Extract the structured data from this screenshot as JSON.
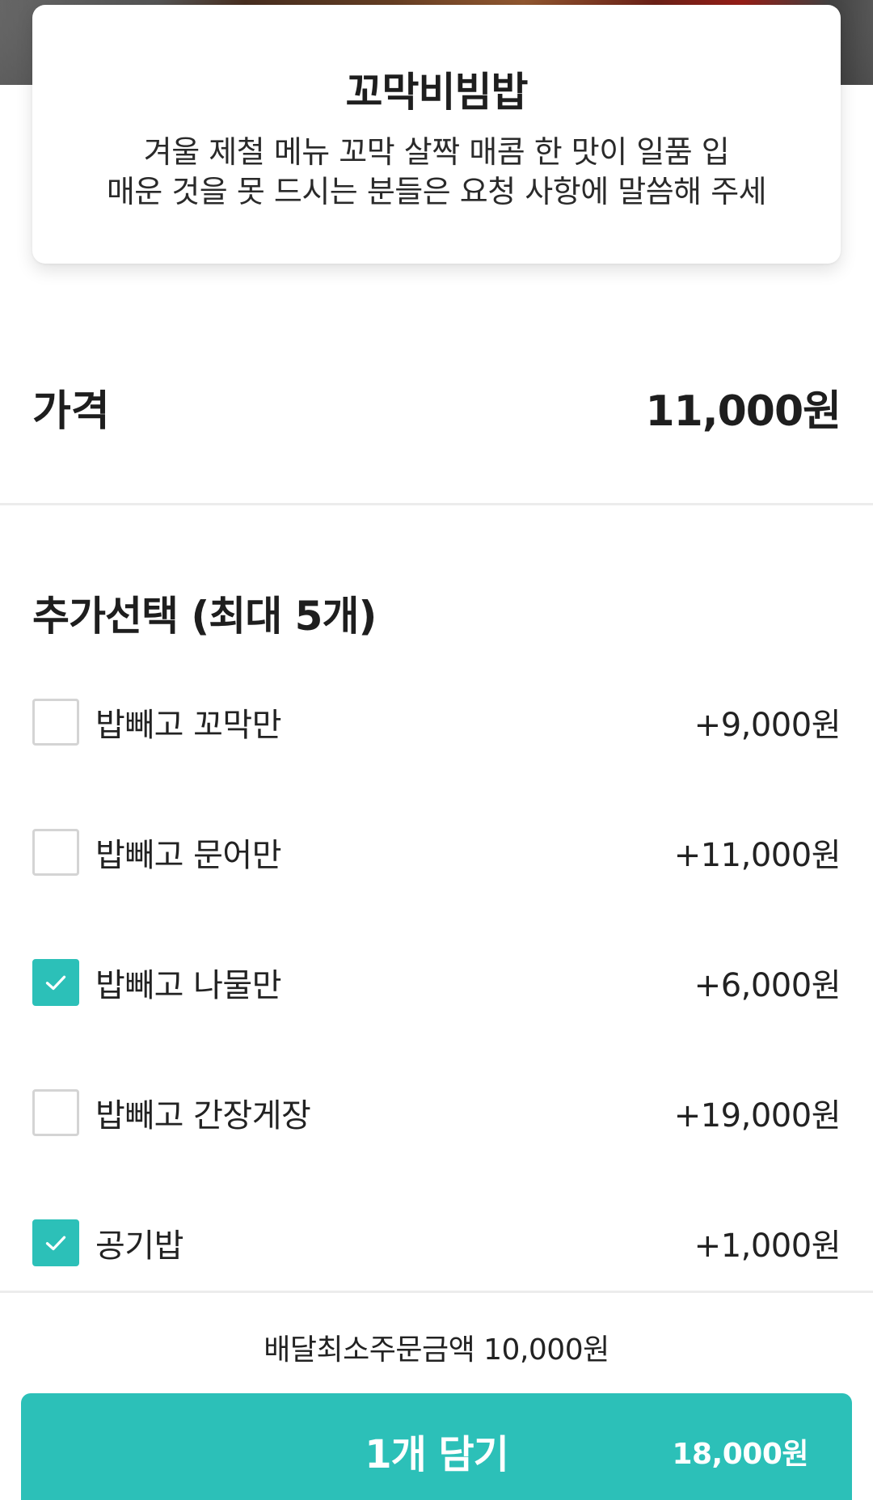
{
  "menu": {
    "title": "꼬막비빔밥",
    "description_line1": "겨울 제철 메뉴 꼬막 살짝 매콤 한 맛이 일품 입",
    "description_line2": "매운 것을 못 드시는 분들은 요청 사항에 말씀해 주세",
    "hero_image": "food-photo"
  },
  "price": {
    "label": "가격",
    "value": "11,000원"
  },
  "options": {
    "title": "추가선택 (최대 5개)",
    "items": [
      {
        "label": "밥빼고 꼬막만",
        "price": "+9,000원",
        "checked": false
      },
      {
        "label": "밥빼고 문어만",
        "price": "+11,000원",
        "checked": false
      },
      {
        "label": "밥빼고 나물만",
        "price": "+6,000원",
        "checked": true
      },
      {
        "label": "밥빼고 간장게장",
        "price": "+19,000원",
        "checked": false
      },
      {
        "label": "공기밥",
        "price": "+1,000원",
        "checked": true
      }
    ]
  },
  "footer": {
    "min_order": "배달최소주문금액 10,000원",
    "cart_label": "1개 담기",
    "cart_total": "18,000원"
  },
  "colors": {
    "accent": "#2cc0b8",
    "checkbox_border": "#d4d4d4",
    "text": "#1e1e1e",
    "divider": "#ececec"
  },
  "icons": {
    "check": "check-icon"
  }
}
